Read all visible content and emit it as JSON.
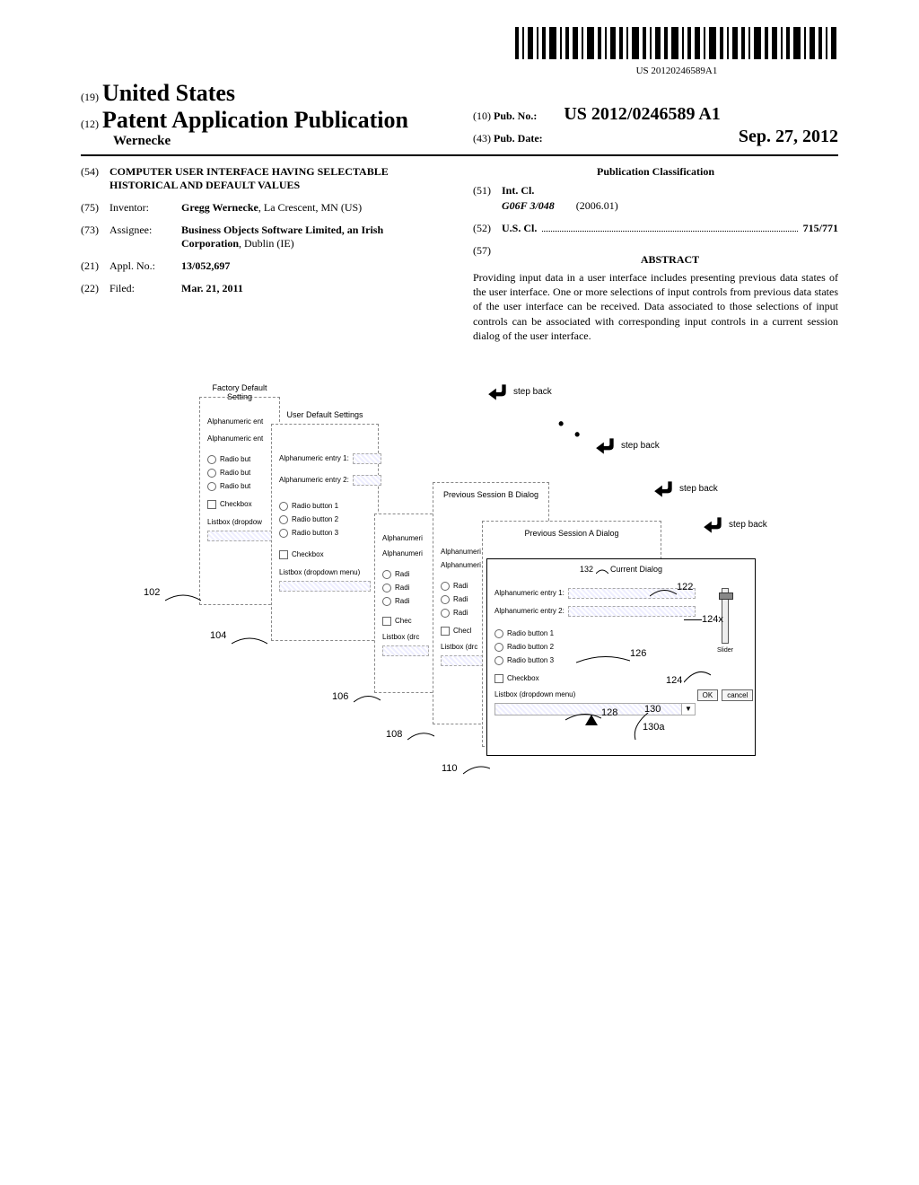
{
  "barcode_text": "US 20120246589A1",
  "header": {
    "code19": "(19)",
    "country": "United States",
    "code12": "(12)",
    "pub_type": "Patent Application Publication",
    "author": "Wernecke",
    "code10": "(10)",
    "pub_no_label": "Pub. No.:",
    "pub_no": "US 2012/0246589 A1",
    "code43": "(43)",
    "pub_date_label": "Pub. Date:",
    "pub_date": "Sep. 27, 2012"
  },
  "left": {
    "f54": {
      "code": "(54)",
      "title": "COMPUTER USER INTERFACE HAVING SELECTABLE HISTORICAL AND DEFAULT VALUES"
    },
    "f75": {
      "code": "(75)",
      "label": "Inventor:",
      "value": "Gregg Wernecke",
      "loc": ", La Crescent, MN (US)"
    },
    "f73": {
      "code": "(73)",
      "label": "Assignee:",
      "value": "Business Objects Software Limited, an Irish Corporation",
      "loc": ", Dublin (IE)"
    },
    "f21": {
      "code": "(21)",
      "label": "Appl. No.:",
      "value": "13/052,697"
    },
    "f22": {
      "code": "(22)",
      "label": "Filed:",
      "value": "Mar. 21, 2011"
    }
  },
  "right": {
    "pub_class": "Publication Classification",
    "f51": {
      "code": "(51)",
      "label": "Int. Cl.",
      "cls": "G06F 3/048",
      "date": "(2006.01)"
    },
    "f52": {
      "code": "(52)",
      "label": "U.S. Cl.",
      "value": "715/771"
    },
    "f57": {
      "code": "(57)",
      "title": "ABSTRACT"
    },
    "abstract": "Providing input data in a user interface includes presenting previous data states of the user interface. One or more selections of input controls from previous data states of the user interface can be received. Data associated to those selections of input controls can be associated with corresponding input controls in a current session dialog of the user interface."
  },
  "fig": {
    "step_back": "step back",
    "titles": {
      "factory": "Factory Default Setting",
      "user": "User Default Settings",
      "prevB": "Previous Session B Dialog",
      "prevA": "Previous Session A Dialog",
      "current": "Current Dialog"
    },
    "labels": {
      "alpha1": "Alphanumeric entry 1:",
      "alpha2": "Alphanumeric entry 2:",
      "alpha_short": "Alphanumeric ent",
      "alpha_shorter": "Alphanumeri",
      "radio1": "Radio button 1",
      "radio2": "Radio button 2",
      "radio3": "Radio button 3",
      "radio_short": "Radio but",
      "radi": "Radi",
      "checkbox": "Checkbox",
      "check": "Chec",
      "check2": "Checl",
      "listbox": "Listbox (dropdown menu)",
      "listbox_short": "Listbox (dropdow",
      "listbox_drc": "Listbox (drc",
      "slider": "Slider",
      "ok": "OK",
      "cancel": "cancel"
    },
    "refs": {
      "r102": "102",
      "r104": "104",
      "r106": "106",
      "r108": "108",
      "r110": "110",
      "r122": "122",
      "r124": "124",
      "r124x": "124x",
      "r126": "126",
      "r128": "128",
      "r130": "130",
      "r130a": "130a",
      "r132": "132"
    }
  }
}
